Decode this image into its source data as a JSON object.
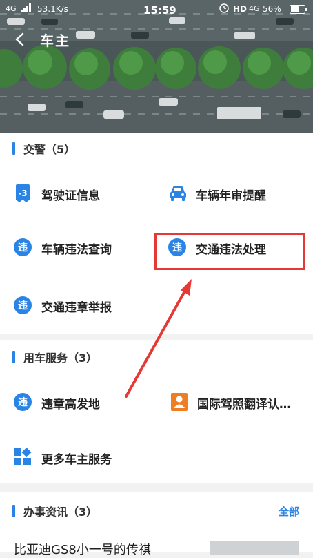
{
  "status_bar": {
    "network": "4G",
    "speed": "53.1K/s",
    "time": "15:59",
    "hd": "HD",
    "network2": "4G",
    "battery": "56%"
  },
  "header": {
    "title": "车主"
  },
  "sections": [
    {
      "title": "交警（5）",
      "items": [
        {
          "label": "驾驶证信息",
          "icon": "license-icon"
        },
        {
          "label": "车辆年审提醒",
          "icon": "car-icon"
        },
        {
          "label": "车辆违法查询",
          "icon": "violation-icon"
        },
        {
          "label": "交通违法处理",
          "icon": "violation-icon"
        },
        {
          "label": "交通违章举报",
          "icon": "violation-icon"
        }
      ]
    },
    {
      "title": "用车服务（3）",
      "items": [
        {
          "label": "违章高发地",
          "icon": "violation-icon"
        },
        {
          "label": "国际驾照翻译认…",
          "icon": "person-card-icon"
        },
        {
          "label": "更多车主服务",
          "icon": "grid-icon"
        }
      ]
    },
    {
      "title": "办事资讯（3）",
      "more": "全部",
      "preview": "比亚迪GS8小一号的传祺"
    }
  ],
  "colors": {
    "accent": "#2a84e6",
    "highlight": "#e53935",
    "orange": "#ef7d22"
  }
}
